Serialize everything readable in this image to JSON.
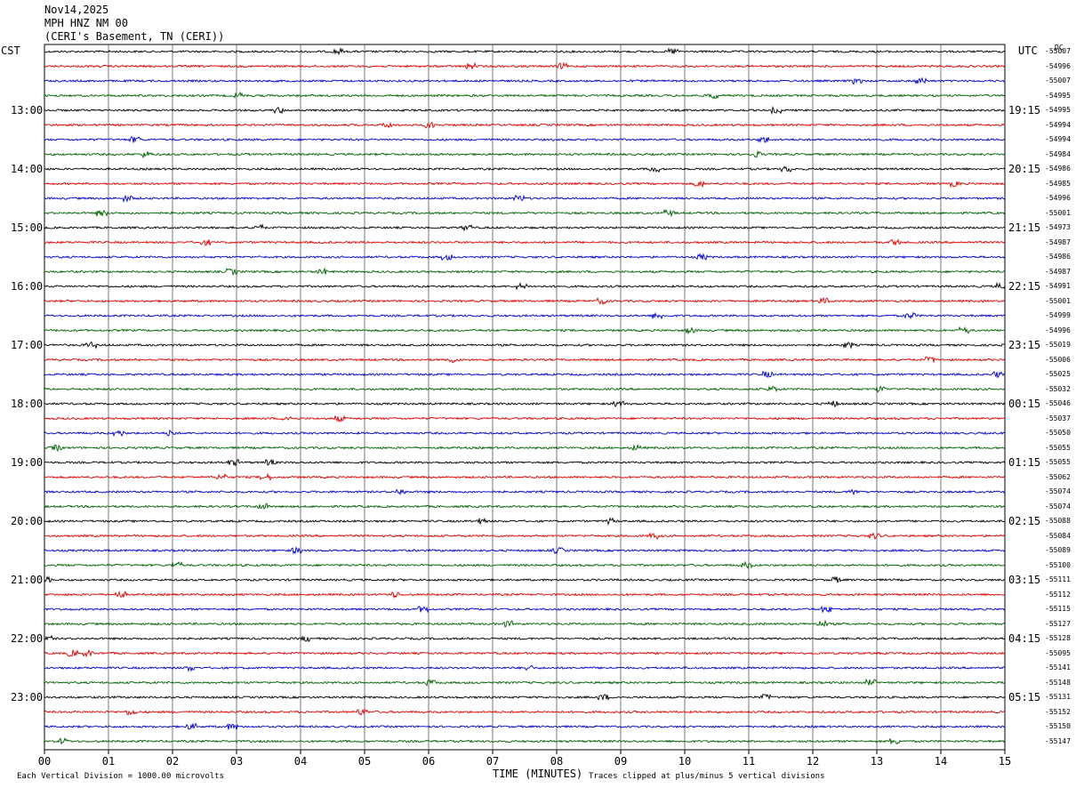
{
  "header": {
    "date": "Nov14,2025",
    "channel": "MPH HNZ NM 00",
    "location": "(CERI's Basement, TN (CERI))"
  },
  "left_tz": "CST",
  "right_tz": "UTC",
  "dc_label": "DC",
  "footer": {
    "scale": "Each Vertical Division = 1000.00 microvolts",
    "xlabel": "TIME (MINUTES)",
    "clip_note": "Traces clipped at plus/minus 5 vertical divisions"
  },
  "chart_data": {
    "type": "line",
    "title": "MPH HNZ NM 00",
    "xlabel": "TIME (MINUTES)",
    "x_ticks": [
      "00",
      "01",
      "02",
      "03",
      "04",
      "05",
      "06",
      "07",
      "08",
      "09",
      "10",
      "11",
      "12",
      "13",
      "14",
      "15"
    ],
    "xlim": [
      0,
      15
    ],
    "trace_colors": [
      "#000000",
      "#e00000",
      "#0000d0",
      "#006000"
    ],
    "trace_count": 48,
    "left_time_labels": [
      {
        "trace": 4,
        "label": "13:00"
      },
      {
        "trace": 8,
        "label": "14:00"
      },
      {
        "trace": 12,
        "label": "15:00"
      },
      {
        "trace": 16,
        "label": "16:00"
      },
      {
        "trace": 20,
        "label": "17:00"
      },
      {
        "trace": 24,
        "label": "18:00"
      },
      {
        "trace": 28,
        "label": "19:00"
      },
      {
        "trace": 32,
        "label": "20:00"
      },
      {
        "trace": 36,
        "label": "21:00"
      },
      {
        "trace": 40,
        "label": "22:00"
      },
      {
        "trace": 44,
        "label": "23:00"
      }
    ],
    "right_time_labels": [
      {
        "trace": 4,
        "label": "19:15"
      },
      {
        "trace": 8,
        "label": "20:15"
      },
      {
        "trace": 12,
        "label": "21:15"
      },
      {
        "trace": 16,
        "label": "22:15"
      },
      {
        "trace": 20,
        "label": "23:15"
      },
      {
        "trace": 24,
        "label": "00:15"
      },
      {
        "trace": 28,
        "label": "01:15"
      },
      {
        "trace": 32,
        "label": "02:15"
      },
      {
        "trace": 36,
        "label": "03:15"
      },
      {
        "trace": 40,
        "label": "04:15"
      },
      {
        "trace": 44,
        "label": "05:15"
      }
    ],
    "dc_offsets": [
      "-55007",
      "-54996",
      "-55007",
      "-54995",
      "-54995",
      "-54994",
      "-54994",
      "-54984",
      "-54986",
      "-54985",
      "-54996",
      "-55001",
      "-54973",
      "-54987",
      "-54986",
      "-54987",
      "-54991",
      "-55001",
      "-54999",
      "-54996",
      "-55019",
      "-55006",
      "-55025",
      "-55032",
      "-55046",
      "-55037",
      "-55050",
      "-55055",
      "-55055",
      "-55062",
      "-55074",
      "-55074",
      "-55088",
      "-55084",
      "-55089",
      "-55100",
      "-55111",
      "-55112",
      "-55115",
      "-55127",
      "-55128",
      "-55095",
      "-55141",
      "-55148",
      "-55131",
      "-55152",
      "-55150",
      "-55147"
    ]
  }
}
